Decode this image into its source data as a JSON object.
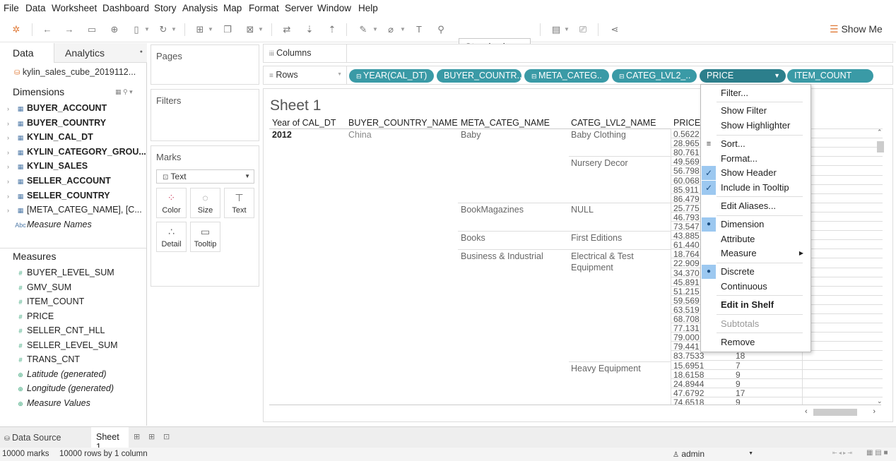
{
  "menu": [
    "File",
    "Data",
    "Worksheet",
    "Dashboard",
    "Story",
    "Analysis",
    "Map",
    "Format",
    "Server",
    "Window",
    "Help"
  ],
  "toolbar": {
    "standard": "Standard",
    "show_me": "Show Me"
  },
  "left": {
    "tab_data": "Data",
    "tab_analytics": "Analytics",
    "datasource": "kylin_sales_cube_2019112...",
    "dimensions_title": "Dimensions",
    "dimensions": [
      {
        "label": "BUYER_ACCOUNT",
        "style": "bold"
      },
      {
        "label": "BUYER_COUNTRY",
        "style": "bold"
      },
      {
        "label": "KYLIN_CAL_DT",
        "style": "bold"
      },
      {
        "label": "KYLIN_CATEGORY_GROU...",
        "style": "bold"
      },
      {
        "label": "KYLIN_SALES",
        "style": "bold"
      },
      {
        "label": "SELLER_ACCOUNT",
        "style": "bold"
      },
      {
        "label": "SELLER_COUNTRY",
        "style": "bold"
      },
      {
        "label": "[META_CATEG_NAME], [C...",
        "style": "normal"
      },
      {
        "label": "Measure Names",
        "style": "italic"
      }
    ],
    "measures_title": "Measures",
    "measures": [
      {
        "label": "BUYER_LEVEL_SUM",
        "style": "normal"
      },
      {
        "label": "GMV_SUM",
        "style": "normal"
      },
      {
        "label": "ITEM_COUNT",
        "style": "normal"
      },
      {
        "label": "PRICE",
        "style": "normal"
      },
      {
        "label": "SELLER_CNT_HLL",
        "style": "normal"
      },
      {
        "label": "SELLER_LEVEL_SUM",
        "style": "normal"
      },
      {
        "label": "TRANS_CNT",
        "style": "normal"
      },
      {
        "label": "Latitude (generated)",
        "style": "italic"
      },
      {
        "label": "Longitude (generated)",
        "style": "italic"
      },
      {
        "label": "Measure Values",
        "style": "italic"
      }
    ]
  },
  "cards": {
    "pages": "Pages",
    "filters": "Filters",
    "marks": "Marks",
    "mark_type": "Text",
    "mark_buttons": [
      "Color",
      "Size",
      "Text",
      "Detail",
      "Tooltip"
    ]
  },
  "shelves": {
    "columns": "Columns",
    "rows": "Rows",
    "pills": [
      "YEAR(CAL_DT)",
      "BUYER_COUNTR..",
      "META_CATEG..",
      "CATEG_LVL2_..",
      "PRICE",
      "ITEM_COUNT"
    ]
  },
  "view": {
    "title": "Sheet 1",
    "headers": [
      "Year of CAL_DT",
      "BUYER_COUNTRY_NAME",
      "META_CATEG_NAME",
      "CATEG_LVL2_NAME",
      "PRICE"
    ],
    "year": "2012",
    "country": "China",
    "meta": [
      "Baby",
      "BookMagazines",
      "Books",
      "Business & Industrial"
    ],
    "lvl2": [
      "Baby Clothing",
      "Nursery Decor",
      "NULL",
      "First Editions",
      "Electrical & Test",
      "Equipment",
      "Heavy Equipment"
    ],
    "prices": [
      "0.5622",
      "28.965",
      "80.761",
      "49.569",
      "56.798",
      "60.068",
      "85.911",
      "86.479",
      "25.775",
      "46.793",
      "73.547",
      "43.885",
      "61.440",
      "18.764",
      "22.909",
      "34.370",
      "45.891",
      "51.215",
      "59.569",
      "63.519",
      "68.708",
      "77.131",
      "79.000",
      "79.441",
      "83.7533",
      "15.6951",
      "18.6158",
      "24.8944",
      "47.6792",
      "74.6518"
    ],
    "counts": [
      "18",
      "7",
      "9",
      "9",
      "17",
      "9"
    ]
  },
  "context_menu": {
    "filter": "Filter...",
    "show_filter": "Show Filter",
    "show_highlighter": "Show Highlighter",
    "sort": "Sort...",
    "format": "Format...",
    "show_header": "Show Header",
    "include_tooltip": "Include in Tooltip",
    "edit_aliases": "Edit Aliases...",
    "dimension": "Dimension",
    "attribute": "Attribute",
    "measure": "Measure",
    "discrete": "Discrete",
    "continuous": "Continuous",
    "edit_in_shelf": "Edit in Shelf",
    "subtotals": "Subtotals",
    "remove": "Remove"
  },
  "bottom": {
    "data_source": "Data Source",
    "sheet": "Sheet 1"
  },
  "status": {
    "marks": "10000 marks",
    "rows": "10000 rows by 1 column",
    "user": "admin"
  }
}
